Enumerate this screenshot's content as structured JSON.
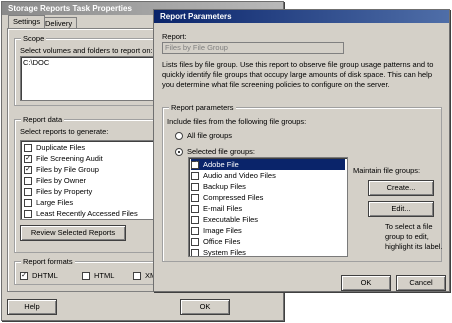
{
  "back": {
    "title": "Storage Reports Task Properties",
    "tabs": [
      "Settings",
      "Delivery"
    ],
    "scope_label": "Scope",
    "scope_prompt": "Select volumes and folders to report on:",
    "scope_paths": [
      "C:\\DOC"
    ],
    "report_data_label": "Report data",
    "reports_prompt": "Select reports to generate:",
    "reports": [
      {
        "label": "Duplicate Files",
        "checked": false
      },
      {
        "label": "File Screening Audit",
        "checked": true
      },
      {
        "label": "Files by File Group",
        "checked": true
      },
      {
        "label": "Files by Owner",
        "checked": false
      },
      {
        "label": "Files by Property",
        "checked": false
      },
      {
        "label": "Large Files",
        "checked": false
      },
      {
        "label": "Least Recently Accessed Files",
        "checked": false
      }
    ],
    "review_button": "Review Selected Reports",
    "formats_label": "Report formats",
    "formats": [
      {
        "label": "DHTML",
        "checked": true
      },
      {
        "label": "HTML",
        "checked": false
      },
      {
        "label": "XML",
        "checked": false
      }
    ],
    "help_button": "Help",
    "ok_button": "OK"
  },
  "front": {
    "title": "Report Parameters",
    "report_label": "Report:",
    "report_value": "Files by File Group",
    "description": "Lists files by file group. Use this report to observe file group usage patterns and to quickly identify file groups that occupy large amounts of disk space. This can help you determine what file screening policies to configure on the server.",
    "params_label": "Report parameters",
    "include_label": "Include files from the following file groups:",
    "radio_all": "All file groups",
    "radio_selected": "Selected file groups:",
    "file_groups": [
      {
        "label": "Adobe File",
        "checked": true,
        "selected": true
      },
      {
        "label": "Audio and Video Files",
        "checked": false,
        "selected": false
      },
      {
        "label": "Backup Files",
        "checked": false,
        "selected": false
      },
      {
        "label": "Compressed Files",
        "checked": false,
        "selected": false
      },
      {
        "label": "E-mail Files",
        "checked": false,
        "selected": false
      },
      {
        "label": "Executable Files",
        "checked": false,
        "selected": false
      },
      {
        "label": "Image Files",
        "checked": false,
        "selected": false
      },
      {
        "label": "Office Files",
        "checked": false,
        "selected": false
      },
      {
        "label": "System Files",
        "checked": false,
        "selected": false
      }
    ],
    "maintain_label": "Maintain file groups:",
    "create_button": "Create...",
    "edit_button": "Edit...",
    "edit_hint": "To select a file group to edit, highlight its label.",
    "ok_button": "OK",
    "cancel_button": "Cancel"
  }
}
